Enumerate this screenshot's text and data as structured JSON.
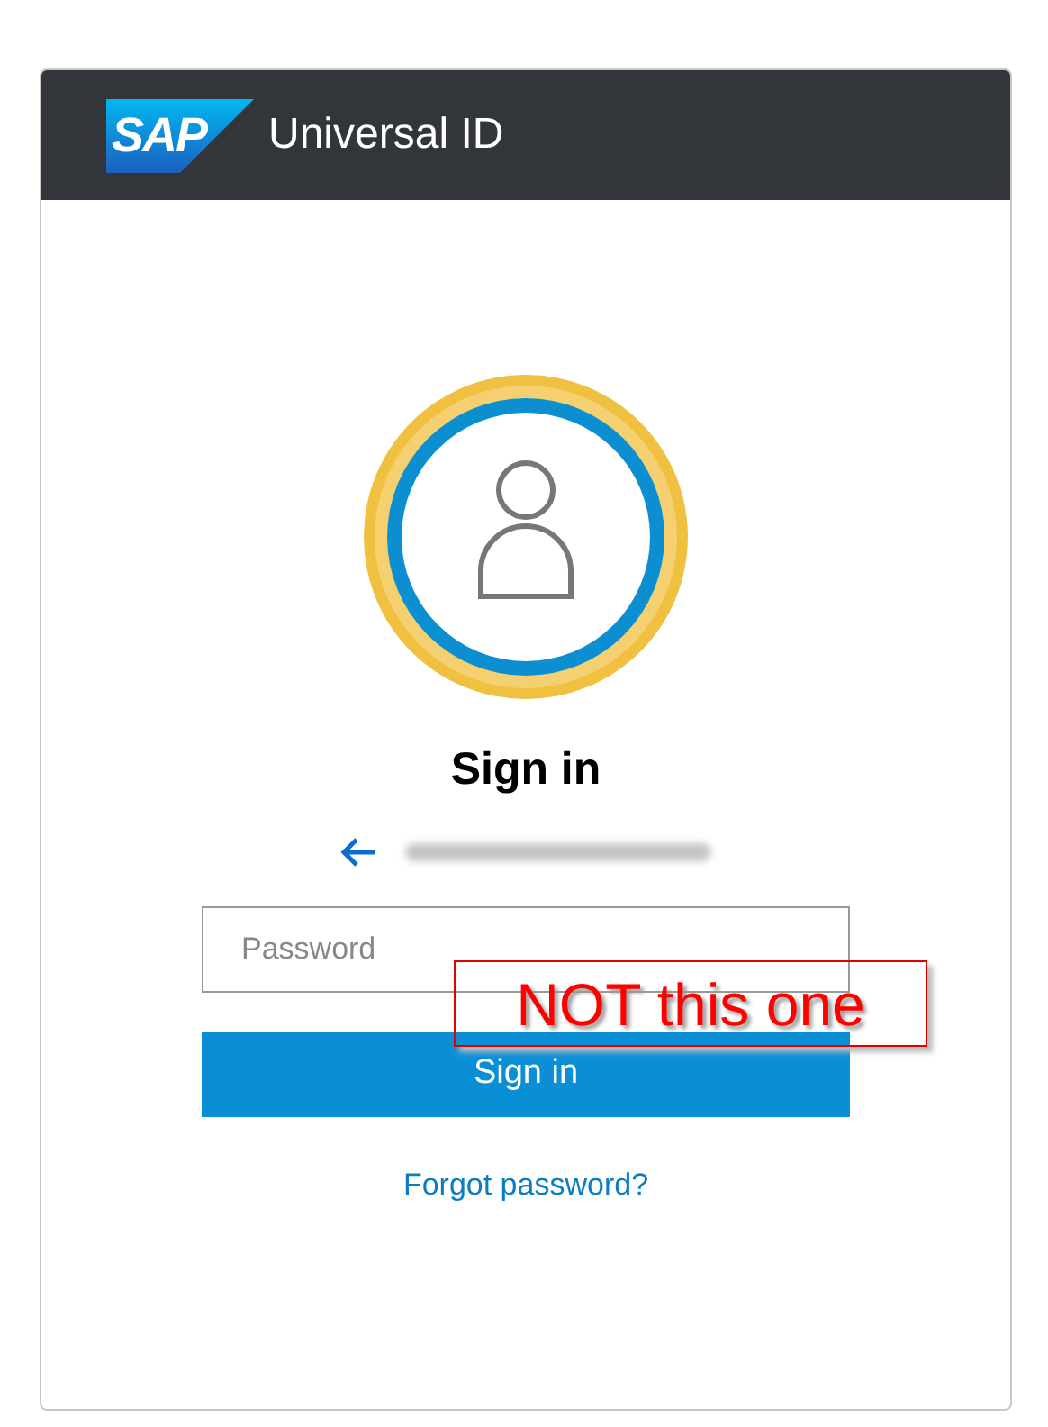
{
  "header": {
    "logo_text": "SAP",
    "title": "Universal ID"
  },
  "heading": "Sign in",
  "password_field": {
    "placeholder": "Password"
  },
  "submit_button": "Sign in",
  "forgot_link": "Forgot password?",
  "annotation": {
    "text": "NOT this one"
  }
}
